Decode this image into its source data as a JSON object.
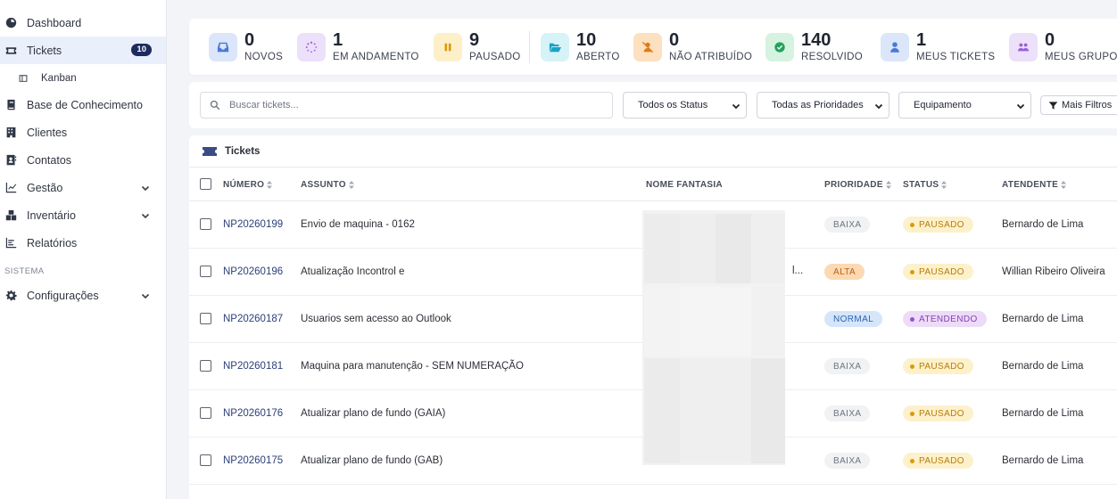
{
  "sidebar": {
    "items": [
      {
        "label": "Dashboard",
        "icon": "gauge-icon"
      },
      {
        "label": "Tickets",
        "icon": "ticket-icon",
        "badge": "10",
        "active": true
      },
      {
        "label": "Kanban",
        "icon": "kanban-icon",
        "sub": true
      },
      {
        "label": "Base de Conhecimento",
        "icon": "book-icon"
      },
      {
        "label": "Clientes",
        "icon": "building-icon"
      },
      {
        "label": "Contatos",
        "icon": "address-book-icon"
      },
      {
        "label": "Gestão",
        "icon": "chart-line-icon",
        "expandable": true
      },
      {
        "label": "Inventário",
        "icon": "boxes-icon",
        "expandable": true
      },
      {
        "label": "Relatórios",
        "icon": "chart-bar-icon"
      }
    ],
    "section_label": "SISTEMA",
    "settings": {
      "label": "Configurações",
      "icon": "gear-icon"
    }
  },
  "stats": [
    {
      "value": "0",
      "label": "NOVOS",
      "icon": "inbox-icon",
      "bg": "#dbe6fb",
      "color": "#4a78d6"
    },
    {
      "value": "1",
      "label": "EM ANDAMENTO",
      "icon": "spinner-icon",
      "bg": "#ece0fa",
      "color": "#9a5fd8"
    },
    {
      "value": "9",
      "label": "PAUSADO",
      "icon": "pause-icon",
      "bg": "#fdf0c9",
      "color": "#d99a0c"
    },
    {
      "value": "10",
      "label": "ABERTO",
      "icon": "folder-open-icon",
      "bg": "#d6f3f8",
      "color": "#1ba3c6"
    },
    {
      "value": "0",
      "label": "NÃO ATRIBUÍDO",
      "icon": "user-slash-icon",
      "bg": "#fde0c0",
      "color": "#e07a17"
    },
    {
      "value": "140",
      "label": "RESOLVIDO",
      "icon": "check-circle-icon",
      "bg": "#d5f3e0",
      "color": "#22a35a"
    },
    {
      "value": "1",
      "label": "MEUS TICKETS",
      "icon": "user-icon",
      "bg": "#dbe6fb",
      "color": "#4a78d6"
    },
    {
      "value": "0",
      "label": "MEUS GRUPOS",
      "icon": "users-icon",
      "bg": "#ece0fa",
      "color": "#9a5fd8"
    }
  ],
  "filters": {
    "search_placeholder": "Buscar tickets...",
    "status": "Todos os Status",
    "priority": "Todas as Prioridades",
    "group": "Equipamento",
    "more": "Mais Filtros"
  },
  "table": {
    "title": "Tickets",
    "columns": {
      "number": "NÚMERO",
      "subject": "ASSUNTO",
      "company": "NOME FANTASIA",
      "priority": "PRIORIDADE",
      "status": "STATUS",
      "agent": "ATENDENTE"
    },
    "rows": [
      {
        "number": "NP20260199",
        "subject": "Envio de maquina - 0162",
        "priority": "BAIXA",
        "priority_class": "baixa",
        "status": "PAUSADO",
        "status_class": "pausado",
        "agent": "Bernardo de Lima"
      },
      {
        "number": "NP20260196",
        "subject": "Atualização Incontrol e",
        "priority": "ALTA",
        "priority_class": "alta",
        "status": "PAUSADO",
        "status_class": "pausado",
        "agent": "Willian Ribeiro Oliveira"
      },
      {
        "number": "NP20260187",
        "subject": "Usuarios sem acesso ao Outlook",
        "priority": "NORMAL",
        "priority_class": "normal",
        "status": "ATENDENDO",
        "status_class": "atendendo",
        "agent": "Bernardo de Lima"
      },
      {
        "number": "NP20260181",
        "subject": "Maquina para manutenção - SEM NUMERAÇÃO",
        "priority": "BAIXA",
        "priority_class": "baixa",
        "status": "PAUSADO",
        "status_class": "pausado",
        "agent": "Bernardo de Lima"
      },
      {
        "number": "NP20260176",
        "subject": "Atualizar plano de fundo (GAIA)",
        "priority": "BAIXA",
        "priority_class": "baixa",
        "status": "PAUSADO",
        "status_class": "pausado",
        "agent": "Bernardo de Lima"
      },
      {
        "number": "NP20260175",
        "subject": "Atualizar plano de fundo (GAB)",
        "priority": "BAIXA",
        "priority_class": "baixa",
        "status": "PAUSADO",
        "status_class": "pausado",
        "agent": "Bernardo de Lima"
      }
    ],
    "truncated_marker": "l..."
  },
  "colors": {
    "pausado_dot": "#d99a0c",
    "atendendo_dot": "#9a4fd0",
    "ticket_icon": "#3a4b86"
  }
}
